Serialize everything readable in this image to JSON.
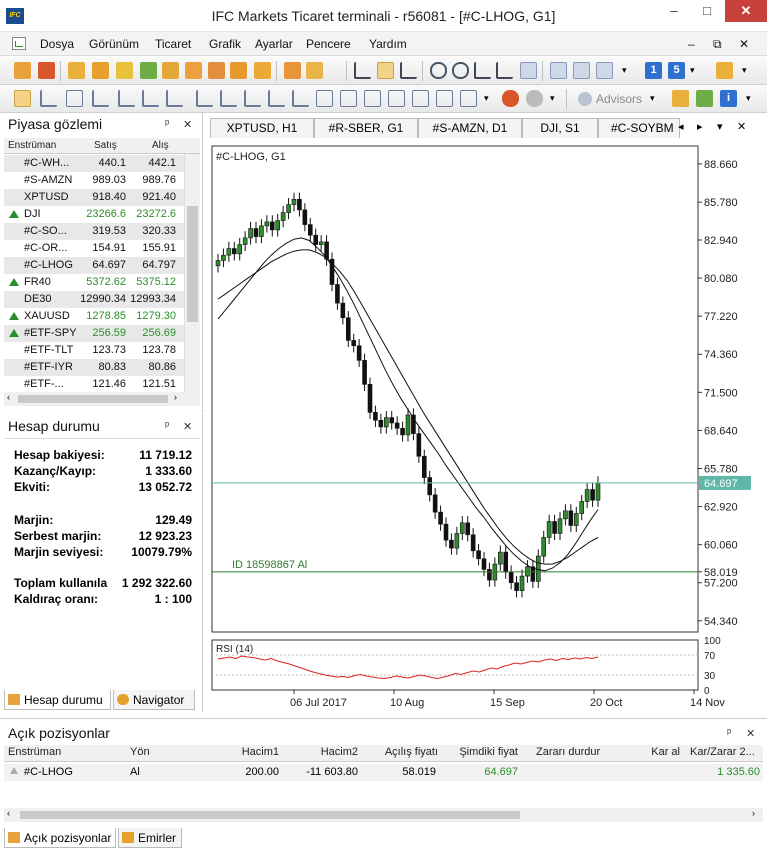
{
  "window": {
    "logo_text": "IFC",
    "title": "IFC Markets Ticaret terminali - r56081 - [#C-LHOG, G1]",
    "minimize": "–",
    "restore": "□",
    "close": "✕"
  },
  "menu": {
    "items": [
      "Dosya",
      "Görünüm",
      "Ticaret",
      "Grafik",
      "Ayarlar",
      "Pencere",
      "Yardım"
    ],
    "doc_minimize": "–",
    "doc_restore": "⧉",
    "doc_close": "✕"
  },
  "toolbar": {
    "advisors_label": "Advisors",
    "num_1": "1",
    "num_5": "5"
  },
  "market_watch": {
    "title": "Piyasa gözlemi",
    "pin": "ᵖ",
    "close": "✕",
    "columns": [
      "Enstrüman",
      "Satış",
      "Alış"
    ],
    "rows": [
      {
        "symbol": "#C-WH...",
        "bid": "440.1",
        "ask": "442.1",
        "up": false,
        "bid_color": "#111111",
        "ask_color": "#111111",
        "bg": "#e8e8e8"
      },
      {
        "symbol": "#S-AMZN",
        "bid": "989.03",
        "ask": "989.76",
        "up": false,
        "bid_color": "#111111",
        "ask_color": "#111111",
        "bg": "#ffffff"
      },
      {
        "symbol": "XPTUSD",
        "bid": "918.40",
        "ask": "921.40",
        "up": false,
        "bid_color": "#111111",
        "ask_color": "#111111",
        "bg": "#e8e8e8"
      },
      {
        "symbol": "DJI",
        "bid": "23266.6",
        "ask": "23272.6",
        "up": true,
        "bid_color": "#2a8f2a",
        "ask_color": "#2a8f2a",
        "bg": "#ffffff"
      },
      {
        "symbol": "#C-SO...",
        "bid": "319.53",
        "ask": "320.33",
        "up": false,
        "bid_color": "#111111",
        "ask_color": "#111111",
        "bg": "#e8e8e8"
      },
      {
        "symbol": "#C-OR...",
        "bid": "154.91",
        "ask": "155.91",
        "up": false,
        "bid_color": "#111111",
        "ask_color": "#111111",
        "bg": "#ffffff"
      },
      {
        "symbol": "#C-LHOG",
        "bid": "64.697",
        "ask": "64.797",
        "up": false,
        "bid_color": "#111111",
        "ask_color": "#111111",
        "bg": "#e8e8e8"
      },
      {
        "symbol": "FR40",
        "bid": "5372.62",
        "ask": "5375.12",
        "up": true,
        "bid_color": "#2a8f2a",
        "ask_color": "#2a8f2a",
        "bg": "#ffffff"
      },
      {
        "symbol": "DE30",
        "bid": "12990.34",
        "ask": "12993.34",
        "up": false,
        "bid_color": "#111111",
        "ask_color": "#111111",
        "bg": "#e8e8e8"
      },
      {
        "symbol": "XAUUSD",
        "bid": "1278.85",
        "ask": "1279.30",
        "up": true,
        "bid_color": "#2a8f2a",
        "ask_color": "#2a8f2a",
        "bg": "#ffffff"
      },
      {
        "symbol": "#ETF-SPY",
        "bid": "256.59",
        "ask": "256.69",
        "up": true,
        "bid_color": "#2a8f2a",
        "ask_color": "#2a8f2a",
        "bg": "#e8e8e8"
      },
      {
        "symbol": "#ETF-TLT",
        "bid": "123.73",
        "ask": "123.78",
        "up": false,
        "bid_color": "#111111",
        "ask_color": "#111111",
        "bg": "#ffffff"
      },
      {
        "symbol": "#ETF-IYR",
        "bid": "80.83",
        "ask": "80.86",
        "up": false,
        "bid_color": "#111111",
        "ask_color": "#111111",
        "bg": "#e8e8e8"
      },
      {
        "symbol": "#ETF-...",
        "bid": "121.46",
        "ask": "121.51",
        "up": false,
        "bid_color": "#111111",
        "ask_color": "#111111",
        "bg": "#ffffff"
      }
    ]
  },
  "account": {
    "title": "Hesap durumu",
    "pin": "ᵖ",
    "close": "✕",
    "lines": [
      {
        "label": "Hesap bakiyesi:",
        "value": "11 719.12"
      },
      {
        "label": "Kazanç/Kayıp:",
        "value": "1 333.60"
      },
      {
        "label": "Ekviti:",
        "value": "13 052.72"
      },
      {
        "label": "Marjin:",
        "value": "129.49"
      },
      {
        "label": "Serbest marjin:",
        "value": "12 923.23"
      },
      {
        "label": "Marjin seviyesi:",
        "value": "10079.79%"
      },
      {
        "label": "Toplam kullanıla",
        "value": "1 292 322.60"
      },
      {
        "label": "Kaldıraç oranı:",
        "value": "1 : 100"
      }
    ],
    "tabs": [
      "Hesap durumu",
      "Navigator"
    ]
  },
  "chart_tabs": {
    "tabs": [
      "XPTUSD, H1",
      "#R-SBER, G1",
      "#S-AMZN, D1",
      "DJI, S1",
      "#C-SOYBM"
    ],
    "nav_left": "◂",
    "nav_right": "▸",
    "nav_down": "▾",
    "close": "✕"
  },
  "chart_data": {
    "type": "candlestick",
    "title": "#C-LHOG, G1",
    "y_ticks": [
      "88.660",
      "85.780",
      "82.940",
      "80.080",
      "77.220",
      "74.360",
      "71.500",
      "68.640",
      "65.780",
      "62.920",
      "60.060",
      "58.019",
      "57.200",
      "54.340"
    ],
    "ylim": [
      53.5,
      90.0
    ],
    "current_price": 64.697,
    "current_price_label": "64.697",
    "position_line": {
      "price": 58.019,
      "label": "ID 18598867 Al"
    },
    "x_labels": [
      "06 Jul 2017",
      "10 Aug",
      "15 Sep",
      "20 Oct",
      "14 Nov"
    ],
    "close_series": [
      81.4,
      81.8,
      82.3,
      81.9,
      82.6,
      83.1,
      83.8,
      83.2,
      84.0,
      84.3,
      83.7,
      84.4,
      85.0,
      85.6,
      86.0,
      85.2,
      84.1,
      83.3,
      82.6,
      82.8,
      81.5,
      79.6,
      78.2,
      77.1,
      75.4,
      75.0,
      73.9,
      72.1,
      70.0,
      69.4,
      68.9,
      69.6,
      69.2,
      68.8,
      68.3,
      69.8,
      68.4,
      66.7,
      65.1,
      63.8,
      62.5,
      61.6,
      60.4,
      59.8,
      60.9,
      61.7,
      60.8,
      59.6,
      59.0,
      58.2,
      57.4,
      58.6,
      59.5,
      58.0,
      57.2,
      56.6,
      57.7,
      58.4,
      57.3,
      59.2,
      60.6,
      61.8,
      60.9,
      62.0,
      62.6,
      61.5,
      62.4,
      63.3,
      64.2,
      63.4,
      64.7
    ],
    "ma_fast_series": [
      77.0,
      77.7,
      78.4,
      79.1,
      79.8,
      80.5,
      81.2,
      81.8,
      82.3,
      82.7,
      83.0,
      83.1,
      82.9,
      82.4,
      81.8,
      81.0,
      80.1,
      79.1,
      78.0,
      76.8,
      75.6,
      74.4,
      73.2,
      72.1,
      71.1,
      70.2,
      69.3,
      68.5,
      67.7,
      66.9,
      66.0,
      65.2,
      64.4,
      63.6,
      62.8,
      62.1,
      61.3,
      60.6,
      59.9,
      59.3,
      58.8,
      58.4,
      58.2,
      58.1,
      58.3,
      58.7,
      59.3,
      60.1,
      61.0,
      61.9,
      62.7
    ],
    "ma_slow_series": [
      78.5,
      78.9,
      79.3,
      79.7,
      80.1,
      80.5,
      80.9,
      81.3,
      81.6,
      81.9,
      82.1,
      82.2,
      82.2,
      82.0,
      81.7,
      81.2,
      80.6,
      79.9,
      79.0,
      78.0,
      77.0,
      76.0,
      75.0,
      74.0,
      73.0,
      72.0,
      71.0,
      70.0,
      69.1,
      68.2,
      67.3,
      66.4,
      65.5,
      64.6,
      63.7,
      62.8,
      62.0,
      61.2,
      60.5,
      59.9,
      59.4,
      59.0,
      58.7,
      58.6,
      58.6,
      58.8,
      59.1,
      59.5,
      59.9,
      60.3,
      60.6
    ],
    "rsi": {
      "label": "RSI (14)",
      "ticks": [
        "100",
        "70",
        "30",
        "0"
      ],
      "levels": [
        70,
        30
      ],
      "values": [
        62,
        64,
        66,
        63,
        68,
        66,
        65,
        62,
        60,
        63,
        58,
        55,
        52,
        48,
        44,
        40,
        36,
        33,
        30,
        28,
        26,
        27,
        25,
        29,
        31,
        28,
        26,
        24,
        23,
        25,
        28,
        26,
        24,
        27,
        30,
        28,
        25,
        23,
        26,
        29,
        33,
        31,
        35,
        38,
        36,
        40,
        44,
        42,
        47,
        50,
        54,
        52,
        55,
        58,
        56,
        60,
        62,
        59,
        63,
        61,
        64,
        62,
        65,
        63,
        66
      ]
    }
  },
  "positions": {
    "title": "Açık pozisyonlar",
    "pin": "ᵖ",
    "close": "✕",
    "columns": [
      "Enstrüman",
      "Yön",
      "Hacim1",
      "Hacim2",
      "Açılış fiyatı",
      "Şimdiki fiyat",
      "Zararı durdur",
      "Kar al",
      "Kar/Zarar 2..."
    ],
    "row": {
      "instrument": "#C-LHOG",
      "direction": "Al",
      "volume1": "200.00",
      "volume2": "-11 603.80",
      "open_price": "58.019",
      "current_price": "64.697",
      "stop_loss": "",
      "take_profit": "",
      "pnl": "1 335.60"
    },
    "tabs": [
      "Açık pozisyonlar",
      "Emirler"
    ]
  },
  "colors": {
    "price_line": "#5fb7a9",
    "position_line": "#2e7d2e",
    "positive": "#2a8f2a",
    "rsi_line": "#d22"
  }
}
